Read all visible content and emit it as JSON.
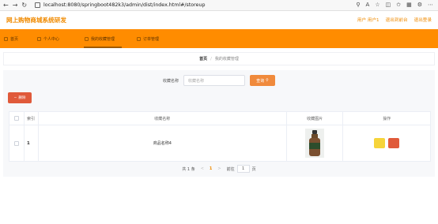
{
  "browser": {
    "url": "localhost:8080/springboot482k3/admin/dist/index.html#/storeup",
    "back_icon": "arrow-left-icon",
    "forward_icon": "arrow-right-icon",
    "reload_icon": "reload-icon"
  },
  "header": {
    "title": "网上购物商城系统研发",
    "user": "用户 用户1",
    "exit_to_front": "退出到前台",
    "logout": "退出登录"
  },
  "nav": {
    "items": [
      {
        "label": "首页"
      },
      {
        "label": "个人中心"
      },
      {
        "label": "我的收藏管理"
      },
      {
        "label": "订单管理"
      }
    ]
  },
  "breadcrumb": {
    "home": "首页",
    "separator": "/",
    "current": "我的收藏管理"
  },
  "search": {
    "label": "收藏名称",
    "placeholder": "收藏名称",
    "button": "查询"
  },
  "toolbar": {
    "delete_label": "删除"
  },
  "table": {
    "headers": {
      "index": "索引",
      "name": "收藏名称",
      "picture": "收藏图片",
      "operation": "操作"
    },
    "rows": [
      {
        "index": "1",
        "name": "商品名称4",
        "picture": "bottle-image"
      }
    ]
  },
  "pagination": {
    "total": "共 1 条",
    "prev": "<",
    "page": "1",
    "next": ">",
    "goto_label": "前往",
    "goto_value": "1",
    "page_unit": "页"
  },
  "colors": {
    "accent": "#ff8c00",
    "title": "#f08a00",
    "danger": "#e05a3a",
    "warning": "#f6d43a"
  }
}
